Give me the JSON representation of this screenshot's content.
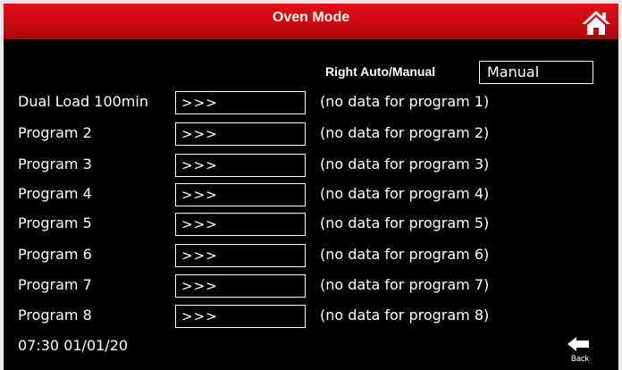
{
  "header": {
    "title": "Oven Mode",
    "home_icon": "home-icon"
  },
  "mode": {
    "label": "Right Auto/Manual",
    "value": "Manual"
  },
  "programs": [
    {
      "name": "Dual Load 100min",
      "button": ">>>",
      "status": "(no data for program 1)"
    },
    {
      "name": "Program 2",
      "button": ">>>",
      "status": "(no data for program 2)"
    },
    {
      "name": "Program 3",
      "button": ">>>",
      "status": "(no data for program 3)"
    },
    {
      "name": "Program 4",
      "button": ">>>",
      "status": "(no data for program 4)"
    },
    {
      "name": "Program 5",
      "button": ">>>",
      "status": "(no data for program 5)"
    },
    {
      "name": "Program 6",
      "button": ">>>",
      "status": "(no data for program 6)"
    },
    {
      "name": "Program 7",
      "button": ">>>",
      "status": "(no data for program 7)"
    },
    {
      "name": "Program 8",
      "button": ">>>",
      "status": "(no data for program 8)"
    }
  ],
  "footer": {
    "clock": "07:30 01/01/20",
    "back_label": "Back",
    "back_icon": "back-arrow-icon"
  },
  "colors": {
    "titlebar": "#d10c12",
    "background": "#000000",
    "text": "#ffffff"
  }
}
